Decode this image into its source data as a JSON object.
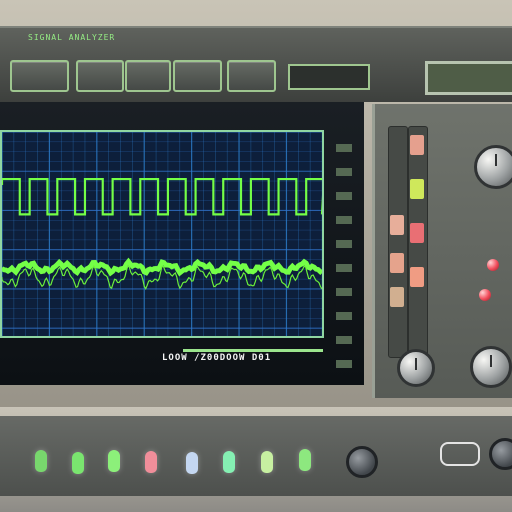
{
  "header": {
    "top_label": "SIGNAL ANALYZER",
    "buttons": [
      "",
      "",
      "",
      "",
      "",
      ""
    ],
    "center_readout": "",
    "mini_label_top": "",
    "mini_label_bottom": "",
    "status_display": ""
  },
  "scope": {
    "header_left": "",
    "header_right": "",
    "footer_left": "",
    "footer_right": "",
    "footer_bottom": "LOOW /Z00DOOW D01",
    "colors": {
      "background": "#0d1f3b",
      "trace": "#74ff47",
      "grid": "#2f86d8",
      "border": "#8fd6a2"
    }
  },
  "right_panel": {
    "header": "",
    "knob_labels": [],
    "slider_count": 2
  },
  "bottom_panel": {
    "labels": "",
    "badge": "",
    "gems": [
      "#78d76d",
      "#7ae56f",
      "#8cf07a",
      "#f08e9a",
      "#c4d7f1",
      "#85f0b3",
      "#c7f0a1",
      "#8de87f"
    ],
    "jack_count": 3
  }
}
